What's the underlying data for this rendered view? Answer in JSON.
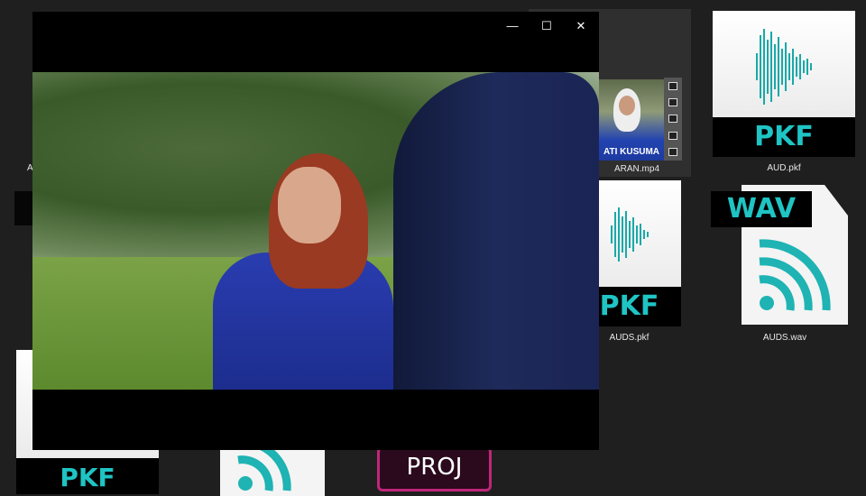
{
  "desktop": {
    "files": [
      {
        "name": "ARAN.mp4",
        "overlay_text": "ATI KUSUMA",
        "type": "video"
      },
      {
        "name": "AUD.pkf",
        "badge": "PKF",
        "type": "pkf"
      },
      {
        "name": "AUDS.pkf",
        "badge": "PKF",
        "type": "pkf"
      },
      {
        "name": "AUDS.wav",
        "badge": "WAV",
        "type": "wav"
      },
      {
        "name": "A",
        "type": "unknown"
      },
      {
        "badge": "PKF",
        "type": "pkf"
      },
      {
        "type": "wav"
      },
      {
        "badge": "PROJ",
        "type": "proj"
      }
    ]
  },
  "player": {
    "minimize": "—",
    "maximize": "☐",
    "close": "✕"
  },
  "colors": {
    "accent": "#1fc4c4",
    "desktop_bg": "#1f1f1f",
    "proj": "#c0267a"
  }
}
